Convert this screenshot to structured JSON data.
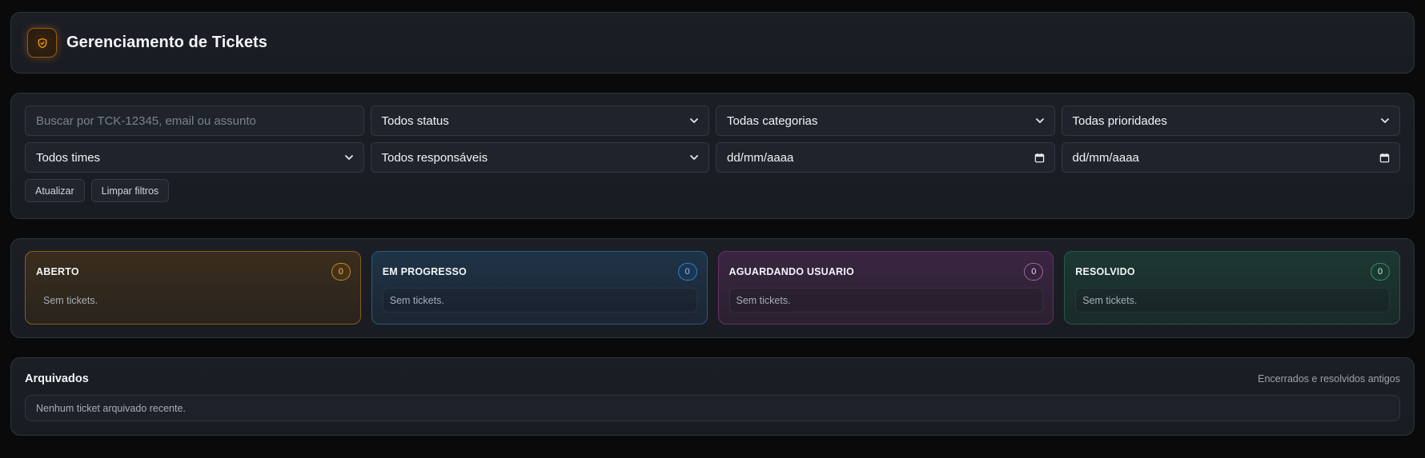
{
  "header": {
    "title": "Gerenciamento de Tickets",
    "icon": "shield-check-icon"
  },
  "filters": {
    "search_placeholder": "Buscar por TCK-12345, email ou assunto",
    "status": "Todos status",
    "categoria": "Todas categorias",
    "prioridade": "Todas prioridades",
    "time": "Todos times",
    "responsavel": "Todos responsáveis",
    "data_inicio": "dd/mm/aaaa",
    "data_fim": "dd/mm/aaaa",
    "atualizar_label": "Atualizar",
    "limpar_label": "Limpar filtros"
  },
  "kanban": {
    "columns": [
      {
        "title": "ABERTO",
        "count": "0",
        "empty": "Sem tickets.",
        "accent": "#c58a26"
      },
      {
        "title": "EM PROGRESSO",
        "count": "0",
        "empty": "Sem tickets.",
        "accent": "#3a7dbd"
      },
      {
        "title": "AGUARDANDO USUARIO",
        "count": "0",
        "empty": "Sem tickets.",
        "accent": "#9a66a4"
      },
      {
        "title": "RESOLVIDO",
        "count": "0",
        "empty": "Sem tickets.",
        "accent": "#3a8c70"
      }
    ]
  },
  "archived": {
    "title": "Arquivados",
    "subtitle": "Encerrados e resolvidos antigos",
    "empty": "Nenhum ticket arquivado recente."
  },
  "colors": {
    "background": "#0a0a0b",
    "panel": "#1b1e25",
    "brand_accent": "#f59e0b"
  }
}
